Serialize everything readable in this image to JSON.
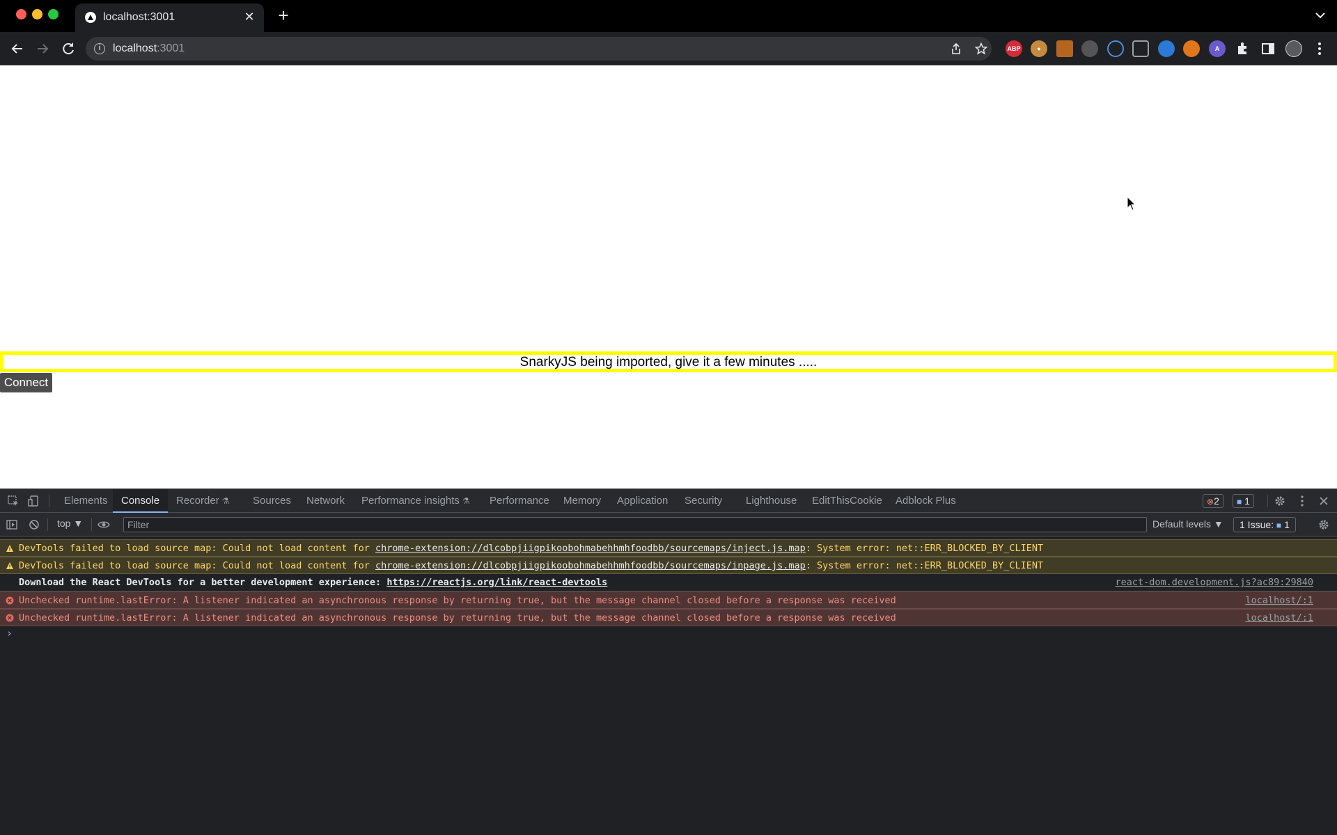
{
  "browser": {
    "tab_title": "localhost:3001",
    "tab_close": "✕",
    "new_tab": "+",
    "url_host": "localhost",
    "url_port": ":3001"
  },
  "page": {
    "status_text": "SnarkyJS being imported, give it a few minutes .....",
    "connect_label": "Connect"
  },
  "devtools": {
    "tabs": [
      "Elements",
      "Console",
      "Recorder",
      "Sources",
      "Network",
      "Performance insights",
      "Performance",
      "Memory",
      "Application",
      "Security",
      "Lighthouse",
      "EditThisCookie",
      "Adblock Plus"
    ],
    "active_tab": "Console",
    "error_count": "2",
    "message_count": "1",
    "context": "top",
    "filter_placeholder": "Filter",
    "levels": "Default levels",
    "issues_label": "1 Issue:",
    "issues_count": "1",
    "messages": [
      {
        "type": "warn",
        "prefix": "DevTools failed to load source map: Could not load content for ",
        "link": "chrome-extension://dlcobpjiigpikoobohmabehhmhfoodbb/sourcemaps/inject.js.map",
        "suffix": ": System error: net::ERR_BLOCKED_BY_CLIENT",
        "source": ""
      },
      {
        "type": "warn",
        "prefix": "DevTools failed to load source map: Could not load content for ",
        "link": "chrome-extension://dlcobpjiigpikoobohmabehhmhfoodbb/sourcemaps/inpage.js.map",
        "suffix": ": System error: net::ERR_BLOCKED_BY_CLIENT",
        "source": ""
      },
      {
        "type": "info",
        "prefix": "Download the React DevTools for a better development experience: ",
        "link": "https://reactjs.org/link/react-devtools",
        "suffix": "",
        "source": "react-dom.development.js?ac89:29840"
      },
      {
        "type": "error",
        "prefix": "Unchecked runtime.lastError: A listener indicated an asynchronous response by returning true, but the message channel closed before a response was received",
        "link": "",
        "suffix": "",
        "source": "localhost/:1"
      },
      {
        "type": "error",
        "prefix": "Unchecked runtime.lastError: A listener indicated an asynchronous response by returning true, but the message channel closed before a response was received",
        "link": "",
        "suffix": "",
        "source": "localhost/:1"
      }
    ],
    "prompt": "›"
  },
  "colors": {
    "status_border": "#ffff00",
    "connect_bg": "#4d4d4d",
    "warn_bg": "#413c26",
    "error_bg": "#4e3534"
  }
}
